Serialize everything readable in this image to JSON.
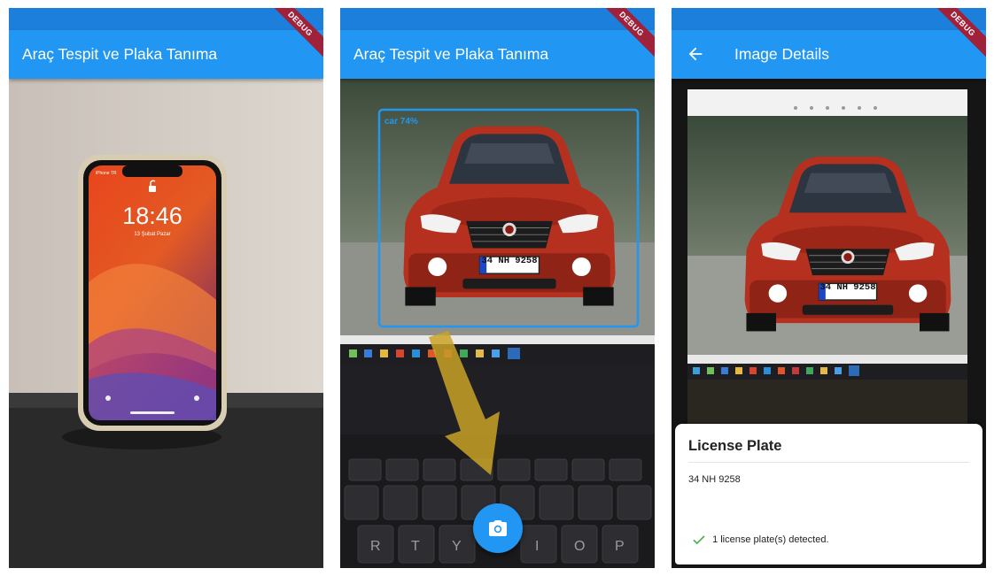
{
  "screens": [
    {
      "app_bar": {
        "title": "Araç Tespit ve Plaka Tanıma"
      },
      "debug_banner": "DEBUG",
      "camera_preview": {
        "phone_lock_screen": {
          "time": "18:46",
          "date": "13 Şubat Pazar",
          "carrier": "iPhone TR"
        }
      }
    },
    {
      "app_bar": {
        "title": "Araç Tespit ve Plaka Tanıma"
      },
      "debug_banner": "DEBUG",
      "camera_preview": {
        "detection_label": "car 74%",
        "plate_text": "34 NH 9258",
        "keyboard_keys": [
          "R",
          "T",
          "Y",
          "I",
          "O",
          "P"
        ]
      },
      "fab": {
        "icon": "camera-icon"
      }
    },
    {
      "app_bar": {
        "title": "Image Details",
        "back_icon": "arrow-back-icon"
      },
      "debug_banner": "DEBUG",
      "photo": {
        "plate_text": "34 NH 9258"
      },
      "bottom_sheet": {
        "title": "License Plate",
        "value": "34 NH 9258",
        "status": "1 license plate(s) detected.",
        "status_icon": "check-icon"
      }
    }
  ],
  "colors": {
    "app_bar": "#2196f3",
    "status_bar": "#1d7fdc",
    "debug_banner": "#a0213a",
    "detection_box": "#2196f3",
    "check": "#4caf50"
  }
}
